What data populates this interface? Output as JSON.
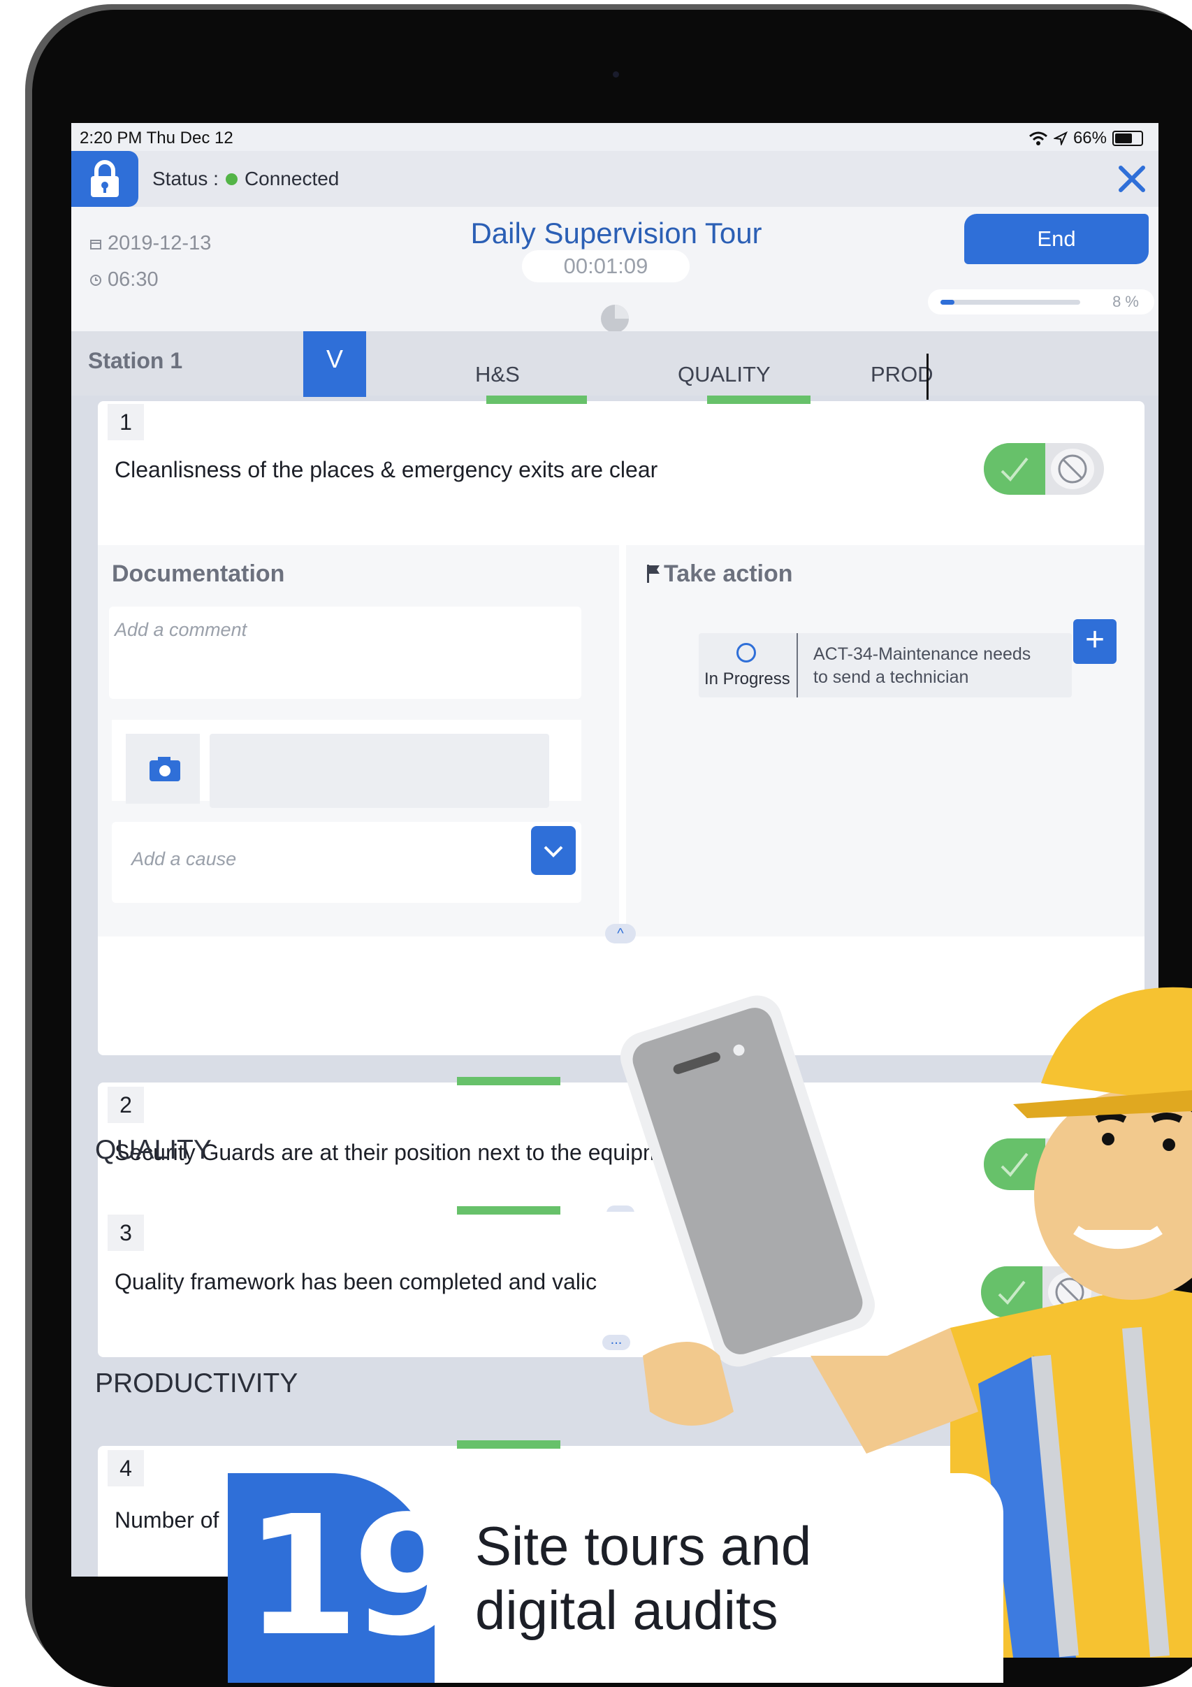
{
  "status_bar": {
    "time": "2:20 PM   Thu Dec 12",
    "battery": "66%"
  },
  "connection": {
    "label": "Status : ",
    "value": "Connected",
    "status_color": "#53b447"
  },
  "header": {
    "date": "2019-12-13",
    "time": "06:30",
    "title": "Daily Supervision Tour",
    "timer": "00:01:09",
    "end_label": "End",
    "progress_percent": 8,
    "progress_label": "8 %"
  },
  "tabs": {
    "station": "Station 1",
    "collapse_label": "V",
    "items": [
      {
        "label": "H&S"
      },
      {
        "label": "QUALITY"
      },
      {
        "label": "PROD"
      }
    ]
  },
  "questions": [
    {
      "number": "1",
      "text": "Cleanlisness of the places & emergency exits are clear"
    },
    {
      "number": "2",
      "text": "Security Guards are at their position next to the equipments"
    },
    {
      "number": "3",
      "text": "Quality framework has been completed and valic"
    },
    {
      "number": "4",
      "text": "Number of"
    }
  ],
  "sections": {
    "quality": "QUALITY",
    "productivity": "PRODUCTIVITY"
  },
  "documentation": {
    "title": "Documentation",
    "comment_placeholder": "Add a comment",
    "cause_placeholder": "Add a cause"
  },
  "take_action": {
    "title": "Take action",
    "action_status": "In Progress",
    "action_line1": "ACT-34-Maintenance needs",
    "action_line2": "to send a technician"
  },
  "promo": {
    "number": "19",
    "line1": "Site tours and",
    "line2": "digital audits"
  },
  "colors": {
    "accent": "#2f6fd8",
    "success": "#67c16a",
    "title_blue": "#2b5fb5"
  },
  "icons": [
    "lock-icon",
    "close-icon",
    "calendar-icon",
    "clock-icon",
    "check-icon",
    "block-icon",
    "flag-icon",
    "camera-icon",
    "chevron-down-icon",
    "chevron-up-icon",
    "plus-icon",
    "wifi-icon",
    "location-icon",
    "battery-icon"
  ]
}
